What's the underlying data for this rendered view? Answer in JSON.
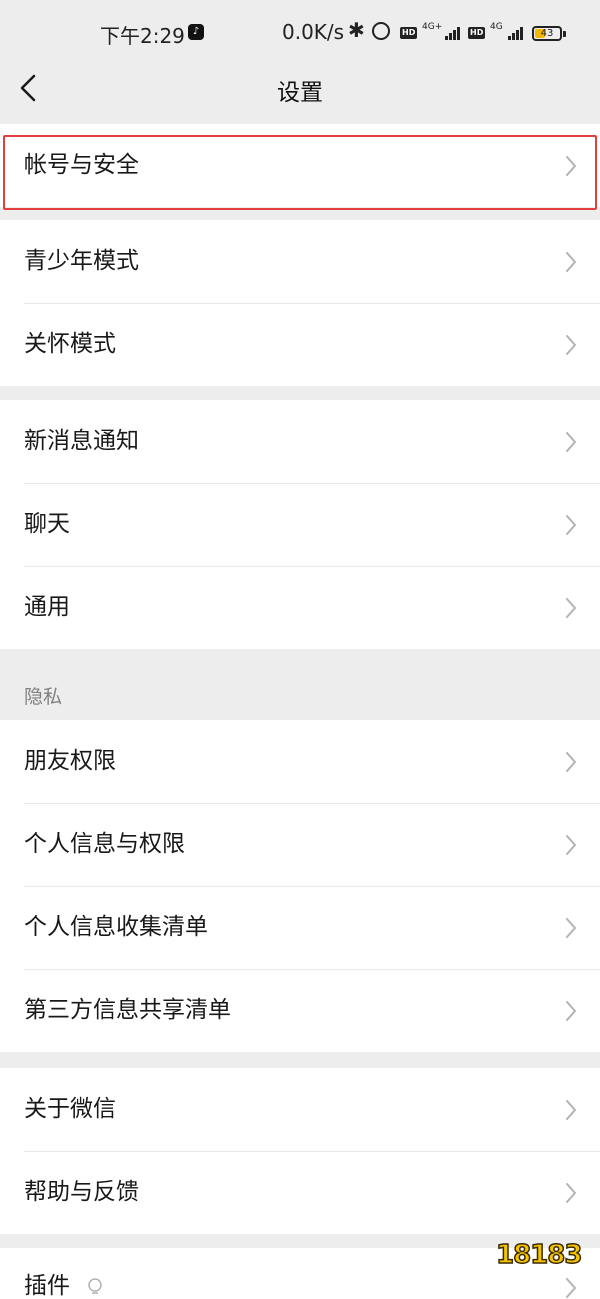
{
  "status_bar": {
    "time": "下午2:29",
    "net_speed": "0.0K/s",
    "net1": "4G+",
    "net2": "4G",
    "hd": "HD",
    "battery": "43",
    "battery_level": 0.43,
    "battery_color": "#f5b800"
  },
  "nav": {
    "title": "设置",
    "back_icon": "chevron-left-icon"
  },
  "groups": {
    "account": {
      "items": [
        {
          "label": "帐号与安全"
        }
      ]
    },
    "modes": {
      "items": [
        {
          "label": "青少年模式"
        },
        {
          "label": "关怀模式"
        }
      ]
    },
    "general": {
      "items": [
        {
          "label": "新消息通知"
        },
        {
          "label": "聊天"
        },
        {
          "label": "通用"
        }
      ]
    },
    "privacy": {
      "title": "隐私",
      "items": [
        {
          "label": "朋友权限"
        },
        {
          "label": "个人信息与权限"
        },
        {
          "label": "个人信息收集清单"
        },
        {
          "label": "第三方信息共享清单"
        }
      ]
    },
    "about": {
      "items": [
        {
          "label": "关于微信"
        },
        {
          "label": "帮助与反馈"
        }
      ]
    },
    "plugins": {
      "items": [
        {
          "label": "插件"
        }
      ]
    }
  },
  "highlight_color": "#e43f3f",
  "watermark": "18183"
}
